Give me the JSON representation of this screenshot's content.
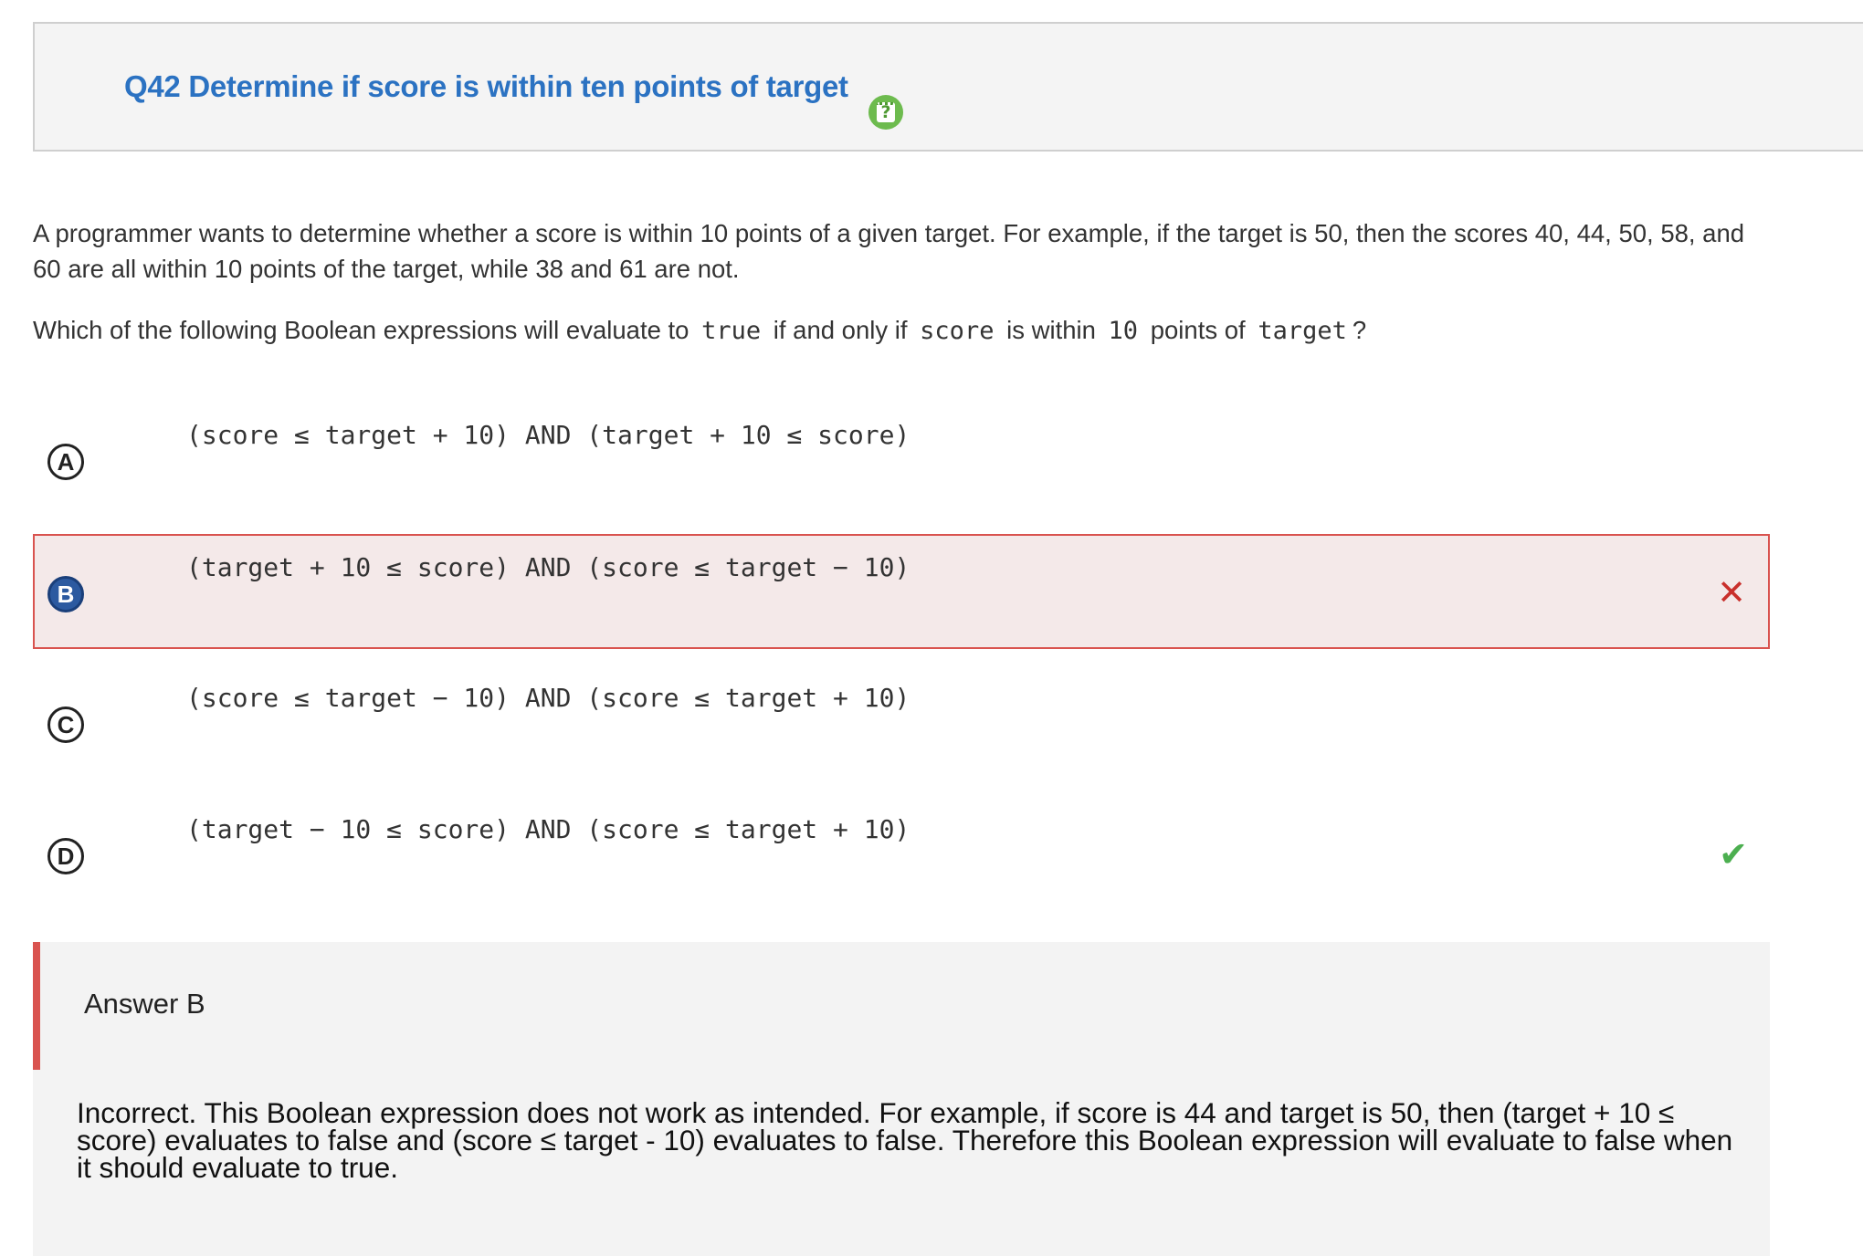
{
  "header": {
    "title": "Q42 Determine if score is within ten points of target",
    "help_icon": "help-icon",
    "accent_color": "#2b72c2"
  },
  "prompt": {
    "text": "A programmer wants to determine whether a score is within 10 points of a given target. For example, if the target is 50, then the scores 40, 44, 50, 58, and 60 are all within 10 points of the target, while 38 and 61 are not.",
    "question_parts": {
      "p1": "Which of the following Boolean expressions will evaluate to",
      "c1": "true",
      "p2": "if and only if",
      "c2": "score",
      "p3": "is within",
      "c3": "10",
      "p4": "points of",
      "c4": "target",
      "p5": "?"
    }
  },
  "options": [
    {
      "letter": "A",
      "code": "(score ≤ target + 10) AND (target + 10 ≤ score)",
      "selected": false,
      "mark": ""
    },
    {
      "letter": "B",
      "code": "(target + 10 ≤ score) AND (score ≤ target − 10)",
      "selected": true,
      "mark": "✕"
    },
    {
      "letter": "C",
      "code": "(score ≤ target − 10) AND (score ≤ target + 10)",
      "selected": false,
      "mark": ""
    },
    {
      "letter": "D",
      "code": "(target − 10 ≤ score) AND (score ≤ target + 10)",
      "selected": false,
      "mark": "✔"
    }
  ],
  "explanation": {
    "label": "Answer B",
    "text": "Incorrect. This Boolean expression does not work as intended. For example, if score is 44 and target is 50, then (target + 10 ≤ score) evaluates to false and (score ≤ target - 10) evaluates to false. Therefore this Boolean expression will evaluate to false when it should evaluate to true.",
    "status_color": "#d9534f"
  }
}
